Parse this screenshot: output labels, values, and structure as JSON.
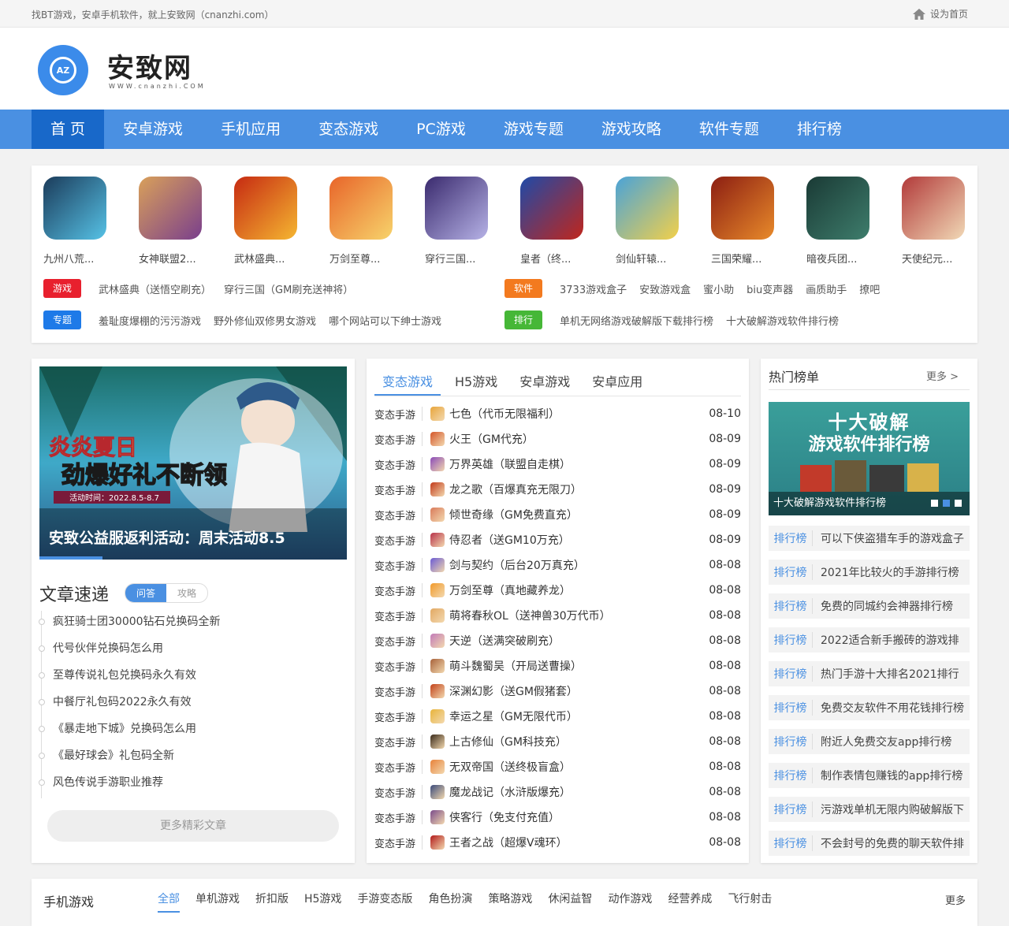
{
  "topbar": {
    "slogan": "找BT游戏，安卓手机软件，就上安致网（cnanzhi.com）",
    "home_label": "设为首页"
  },
  "logo": {
    "mark": "AZ",
    "name": "安致网",
    "sub": "WWW.cnanzhi.COM"
  },
  "nav": [
    "首 页",
    "安卓游戏",
    "手机应用",
    "变态游戏",
    "PC游戏",
    "游戏专题",
    "游戏攻略",
    "软件专题",
    "排行榜"
  ],
  "apps": [
    {
      "name": "九州八荒...",
      "color1": "#1b3b5a",
      "color2": "#56c2e6"
    },
    {
      "name": "女神联盟2...",
      "color1": "#d9a05a",
      "color2": "#7a3f8c"
    },
    {
      "name": "武林盛典...",
      "color1": "#c62a12",
      "color2": "#f5b631"
    },
    {
      "name": "万剑至尊...",
      "color1": "#e8652a",
      "color2": "#f7d36b"
    },
    {
      "name": "穿行三国...",
      "color1": "#3a2a6e",
      "color2": "#b6b2e6"
    },
    {
      "name": "皇者（终...",
      "color1": "#1f4aa8",
      "color2": "#c0261c"
    },
    {
      "name": "剑仙轩辕...",
      "color1": "#4aa3d8",
      "color2": "#f2d04a"
    },
    {
      "name": "三国荣耀...",
      "color1": "#8c1e12",
      "color2": "#e88a2a"
    },
    {
      "name": "暗夜兵团...",
      "color1": "#1a3a35",
      "color2": "#3e7d6c"
    },
    {
      "name": "天使纪元...",
      "color1": "#b23a3a",
      "color2": "#f1d9b6"
    }
  ],
  "tag_rows": [
    {
      "tag": "游戏",
      "color": "#e8202e",
      "links": [
        "武林盛典（送悟空刷充）",
        "穿行三国（GM刷充送神将）"
      ]
    },
    {
      "tag": "软件",
      "color": "#f37a1f",
      "links": [
        "3733游戏盒子",
        "安致游戏盒",
        "蜜小助",
        "biu变声器",
        "画质助手",
        "撩吧"
      ]
    },
    {
      "tag": "专题",
      "color": "#1e7ae8",
      "links": [
        "羞耻度爆棚的污污游戏",
        "野外修仙双修男女游戏",
        "哪个网站可以下绅士游戏"
      ]
    },
    {
      "tag": "排行",
      "color": "#46b737",
      "links": [
        "单机无网络游戏破解版下载排行榜",
        "十大破解游戏软件排行榜"
      ]
    }
  ],
  "banner": {
    "promo_line1": "炎炎夏日",
    "promo_line2": "劲爆好礼不断领",
    "promo_time": "活动时间：2022.8.5-8.7",
    "caption": "安致公益服返利活动：周末活动8.5"
  },
  "articles": {
    "title": "文章速递",
    "tabs": [
      "问答",
      "攻略"
    ],
    "items": [
      "疯狂骑士团30000钻石兑换码全新",
      "代号伙伴兑换码怎么用",
      "至尊传说礼包兑换码永久有效",
      "中餐厅礼包码2022永久有效",
      "《暴走地下城》兑换码怎么用",
      "《最好球会》礼包码全新",
      "风色传说手游职业推荐"
    ],
    "more": "更多精彩文章"
  },
  "games": {
    "tabs": [
      "变态游戏",
      "H5游戏",
      "安卓游戏",
      "安卓应用"
    ],
    "cat": "变态手游",
    "items": [
      {
        "name": "七色（代币无限福利）",
        "date": "08-10",
        "color": "#e8a53a"
      },
      {
        "name": "火王（GM代充）",
        "date": "08-09",
        "color": "#d4562a"
      },
      {
        "name": "万界英雄（联盟自走棋）",
        "date": "08-09",
        "color": "#8a4ab8"
      },
      {
        "name": "龙之歌（百爆真充无限刀）",
        "date": "08-09",
        "color": "#c23a1a"
      },
      {
        "name": "倾世奇缘（GM免费直充）",
        "date": "08-09",
        "color": "#d97a5a"
      },
      {
        "name": "侍忍者（送GM10万充）",
        "date": "08-09",
        "color": "#b8324a"
      },
      {
        "name": "剑与契约（后台20万真充）",
        "date": "08-08",
        "color": "#6a5ad4"
      },
      {
        "name": "万剑至尊（真地藏养龙）",
        "date": "08-08",
        "color": "#f29a2a"
      },
      {
        "name": "萌将春秋OL（送神兽30万代币）",
        "date": "08-08",
        "color": "#e2a862"
      },
      {
        "name": "天逆（送满突破刷充）",
        "date": "08-08",
        "color": "#c27ab8"
      },
      {
        "name": "萌斗魏蜀吴（开局送曹操）",
        "date": "08-08",
        "color": "#a8623a"
      },
      {
        "name": "深渊幻影（送GM假猪套）",
        "date": "08-08",
        "color": "#c2421a"
      },
      {
        "name": "幸运之星（GM无限代币）",
        "date": "08-08",
        "color": "#e8b43a"
      },
      {
        "name": "上古修仙（GM科技充）",
        "date": "08-08",
        "color": "#3a2a1a"
      },
      {
        "name": "无双帝国（送终极盲盒）",
        "date": "08-08",
        "color": "#e8823a"
      },
      {
        "name": "魔龙战记（水浒版爆充）",
        "date": "08-08",
        "color": "#3a4a7a"
      },
      {
        "name": "侠客行（免支付充值）",
        "date": "08-08",
        "color": "#7a4a8a"
      },
      {
        "name": "王者之战（超爆V魂环）",
        "date": "08-08",
        "color": "#b21a1a"
      }
    ]
  },
  "hot": {
    "title": "热门榜单",
    "more": "更多 >",
    "banner_line1": "十大破解",
    "banner_line2": "游戏软件排行榜",
    "banner_caption": "十大破解游戏软件排行榜",
    "tag": "排行榜",
    "items": [
      "可以下侠盗猎车手的游戏盒子",
      "2021年比较火的手游排行榜",
      "免费的同城约会神器排行榜",
      "2022适合新手搬砖的游戏排",
      "热门手游十大排名2021排行",
      "免费交友软件不用花钱排行榜",
      "附近人免费交友app排行榜",
      "制作表情包赚钱的app排行榜",
      "污游戏单机无限内购破解版下",
      "不会封号的免费的聊天软件排"
    ]
  },
  "bottom": {
    "title": "手机游戏",
    "cats": [
      "全部",
      "单机游戏",
      "折扣版",
      "H5游戏",
      "手游变态版",
      "角色扮演",
      "策略游戏",
      "休闲益智",
      "动作游戏",
      "经营养成",
      "飞行射击"
    ],
    "more": "更多"
  }
}
